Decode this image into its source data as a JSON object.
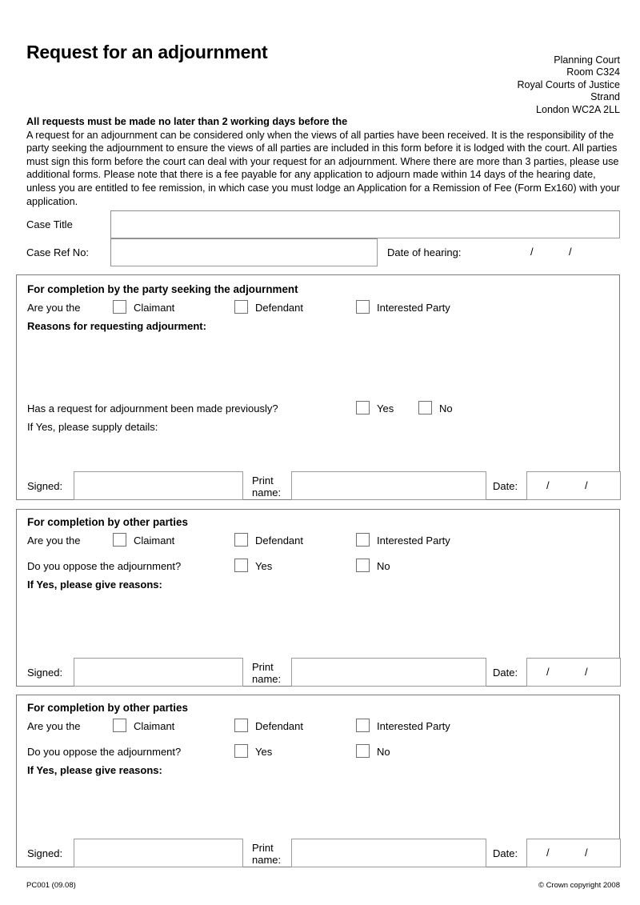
{
  "header": {
    "title": "Request for an adjournment",
    "court_address": [
      "Planning Court",
      "Room C324",
      "Royal Courts of Justice",
      "Strand",
      "London WC2A 2LL"
    ]
  },
  "intro": {
    "lead": "All requests must be made no later than 2 working days before the",
    "body": "A request for an adjournment can be considered only when the views of all parties have been received. It is the responsibility of the party seeking the adjournment to ensure the views of all parties are included in this form before it is lodged with the court. All parties must sign this form before the court can deal with your request for an adjournment. Where there are more than 3 parties, please use additional forms. Please note that there is a fee payable for any application to adjourn made within 14 days of the hearing date, unless you are entitled to fee remission, in which case you must lodge an Application for a Remission of Fee (Form Ex160) with your application."
  },
  "case_fields": {
    "case_title_label": "Case Title",
    "case_title_value": "",
    "case_ref_label": "Case Ref No:",
    "case_ref_value": "",
    "date_of_hearing_label": "Date of hearing:",
    "date_separator": "/",
    "date_day": "",
    "date_month": "",
    "date_year": ""
  },
  "section1": {
    "heading": "For completion by the party seeking the adjournment",
    "are_you_the": "Are you the",
    "party_options": [
      "Claimant",
      "Defendant",
      "Interested Party"
    ],
    "reasons_label": "Reasons for requesting adjourment:",
    "reasons_value": "",
    "previous_question": "Has a request for adjournment been made previously?",
    "yes_label": "Yes",
    "no_label": "No",
    "if_yes_label": "If Yes, please supply details:",
    "if_yes_value": ""
  },
  "section2": {
    "heading": "For completion by other parties",
    "are_you_the": "Are you the",
    "party_options": [
      "Claimant",
      "Defendant",
      "Interested Party"
    ],
    "oppose_question": "Do you oppose the adjournment?",
    "yes_label": "Yes",
    "no_label": "No",
    "if_yes_label": "If Yes, please give reasons:",
    "if_yes_value": ""
  },
  "section3": {
    "heading": "For completion by other parties",
    "are_you_the": "Are you the",
    "party_options": [
      "Claimant",
      "Defendant",
      "Interested Party"
    ],
    "oppose_question": "Do you oppose the adjournment?",
    "yes_label": "Yes",
    "no_label": "No",
    "if_yes_label": "If Yes, please give reasons:",
    "if_yes_value": ""
  },
  "signature": {
    "signed_label": "Signed:",
    "print_name_line1": "Print",
    "print_name_line2": "name:",
    "date_label": "Date:",
    "date_separator": "/",
    "signed_value": "",
    "print_name_value": "",
    "date_value": ""
  },
  "footer": {
    "form_code": "PC001 (09.08)",
    "copyright": "© Crown copyright 2008"
  }
}
